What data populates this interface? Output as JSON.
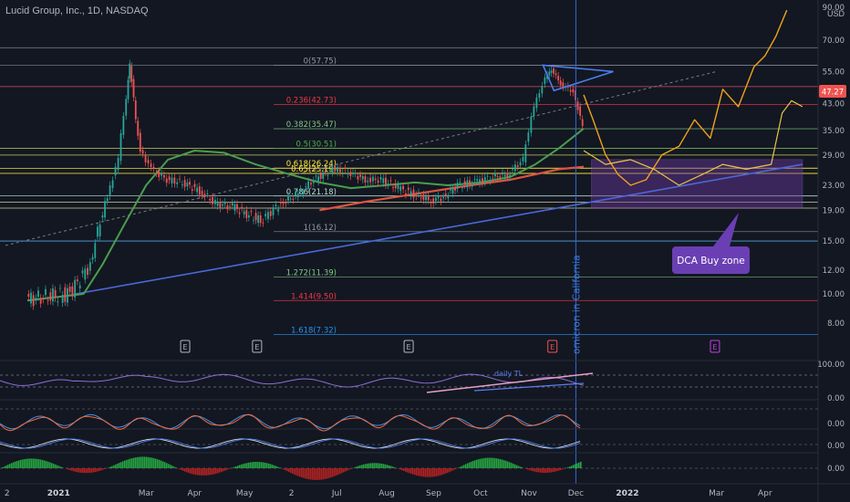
{
  "title": "Lucid Group, Inc., 1D, NASDAQ",
  "currency": "USD",
  "price_label": "47.27",
  "colors": {
    "bg": "#131722",
    "up": "#26a69a",
    "down": "#ef5350",
    "ma_green": "#4a9e4e",
    "ma_red": "#e0533f",
    "trend_blue": "#4a68d8",
    "proj_orange": "#f0a31c",
    "dca_box": "#6b3a9e",
    "vline": "#2f6bd6"
  },
  "chart_data": {
    "type": "line",
    "scale": "log",
    "ylim": [
      6,
      90
    ],
    "y_ticks": [
      "90.00",
      "70.00",
      "55.00",
      "43.00",
      "35.00",
      "29.00",
      "23.00",
      "19.00",
      "15.00",
      "12.00",
      "10.00",
      "8.00"
    ],
    "x_ticks": [
      "2",
      "2021",
      "Mar",
      "Apr",
      "May",
      "2",
      "Jul",
      "Aug",
      "Sep",
      "Oct",
      "Nov",
      "Dec",
      "2022",
      "Mar",
      "Apr"
    ],
    "fib_levels": [
      {
        "label": "0(57.75)",
        "value": 57.75,
        "color": "#9598a1"
      },
      {
        "label": "0.236(42.73)",
        "value": 42.73,
        "color": "#f23645"
      },
      {
        "label": "0.382(35.47)",
        "value": 35.47,
        "color": "#81c784"
      },
      {
        "label": "0.5(30.51)",
        "value": 30.51,
        "color": "#4caf50"
      },
      {
        "label": "0.618(26.24)",
        "value": 26.24,
        "color": "#ffeb3b"
      },
      {
        "label": "0.65(25.19)",
        "value": 25.19,
        "color": "#ffeb3b"
      },
      {
        "label": "0.786(21.18)",
        "value": 21.18,
        "color": "#b5dcc8"
      },
      {
        "label": "1(16.12)",
        "value": 16.12,
        "color": "#9598a1"
      },
      {
        "label": "1.272(11.39)",
        "value": 11.39,
        "color": "#81c784"
      },
      {
        "label": "1.414(9.50)",
        "value": 9.5,
        "color": "#f23645"
      },
      {
        "label": "1.618(7.32)",
        "value": 7.32,
        "color": "#2196f3"
      }
    ],
    "earnings_markers": [
      "E",
      "E",
      "E",
      "E",
      "E"
    ],
    "annotations": {
      "vertical_text": "omicron in California",
      "dca_label": "DCA Buy zone",
      "rsi_text": "daily TL"
    },
    "price_series": {
      "name": "Lucid Group, Inc.",
      "dates": [
        "2020-12-15",
        "2021-01-12",
        "2021-01-25",
        "2021-02-05",
        "2021-02-12",
        "2021-02-17",
        "2021-02-19",
        "2021-02-23",
        "2021-02-26",
        "2021-03-05",
        "2021-03-15",
        "2021-03-25",
        "2021-04-05",
        "2021-04-15",
        "2021-04-26",
        "2021-05-05",
        "2021-05-14",
        "2021-05-27",
        "2021-06-07",
        "2021-06-17",
        "2021-06-29",
        "2021-07-09",
        "2021-07-20",
        "2021-07-30",
        "2021-08-10",
        "2021-08-20",
        "2021-08-31",
        "2021-09-08",
        "2021-09-17",
        "2021-09-28",
        "2021-10-08",
        "2021-10-19",
        "2021-10-29",
        "2021-11-05",
        "2021-11-12",
        "2021-11-16",
        "2021-11-22",
        "2021-11-30",
        "2021-12-06"
      ],
      "values": [
        9.6,
        10.0,
        12.5,
        21.0,
        28.0,
        45.0,
        58.0,
        38.0,
        30.0,
        26.0,
        24.0,
        23.5,
        22.0,
        20.0,
        19.5,
        18.5,
        17.5,
        20.0,
        21.5,
        24.0,
        26.0,
        25.5,
        24.0,
        24.0,
        22.5,
        21.5,
        20.5,
        21.0,
        23.0,
        23.5,
        24.5,
        25.0,
        28.0,
        42.0,
        52.0,
        56.0,
        50.0,
        47.0,
        36.0
      ]
    },
    "projection_orange": {
      "dates": [
        "2021-12-06",
        "2021-12-12",
        "2021-12-20",
        "2021-12-28",
        "2022-01-05",
        "2022-01-15",
        "2022-01-25",
        "2022-02-05",
        "2022-02-15",
        "2022-02-25",
        "2022-03-05",
        "2022-03-15",
        "2022-03-25",
        "2022-04-01",
        "2022-04-08",
        "2022-04-15"
      ],
      "values": [
        46,
        38,
        29,
        25,
        23,
        24,
        29,
        31,
        38,
        33,
        48,
        42,
        57,
        62,
        72,
        88
      ]
    },
    "projection_yellow": {
      "dates": [
        "2021-12-06",
        "2021-12-20",
        "2022-01-05",
        "2022-01-20",
        "2022-02-05",
        "2022-02-20",
        "2022-03-05",
        "2022-03-20",
        "2022-04-05",
        "2022-04-12",
        "2022-04-18",
        "2022-04-25"
      ],
      "values": [
        30,
        27,
        28,
        26,
        23,
        25,
        27,
        26,
        27,
        40,
        44,
        42
      ]
    },
    "ma_green": {
      "dates": [
        "2020-12-15",
        "2021-01-20",
        "2021-02-01",
        "2021-02-15",
        "2021-03-01",
        "2021-03-15",
        "2021-04-01",
        "2021-04-20",
        "2021-05-10",
        "2021-06-01",
        "2021-06-20",
        "2021-07-10",
        "2021-08-01",
        "2021-08-20",
        "2021-09-10",
        "2021-10-01",
        "2021-10-20",
        "2021-11-05",
        "2021-11-20",
        "2021-12-06"
      ],
      "values": [
        9.5,
        10.0,
        12.5,
        17.0,
        23.0,
        28.0,
        30.0,
        29.5,
        27.0,
        25.0,
        23.5,
        22.5,
        23.0,
        23.5,
        23.0,
        23.5,
        24.5,
        27.0,
        30.5,
        35.5
      ]
    },
    "ma_red": {
      "dates": [
        "2021-06-20",
        "2021-07-20",
        "2021-08-20",
        "2021-09-20",
        "2021-10-20",
        "2021-11-05",
        "2021-11-20",
        "2021-12-06"
      ],
      "values": [
        19.0,
        20.3,
        21.5,
        22.8,
        24.0,
        25.0,
        26.0,
        26.5
      ]
    },
    "trend_blue": {
      "dates": [
        "2021-01-15",
        "2022-04-25"
      ],
      "values": [
        10.0,
        27.0
      ]
    },
    "trend_dashed": {
      "dates": [
        "2020-12-01",
        "2022-03-01"
      ],
      "values": [
        14.5,
        55.0
      ]
    },
    "triangle": {
      "dates": [
        "2021-11-10",
        "2021-12-25",
        "2021-11-17"
      ],
      "values": [
        57.75,
        55.0,
        47.5
      ]
    },
    "dca_zone": {
      "from": "2021-12-11",
      "to": "2022-04-25",
      "low": 19.3,
      "high": 28.0
    },
    "omicron_date": "2021-12-01",
    "hlines_extra": [
      {
        "value": 66.0,
        "color": "#7c7f89"
      },
      {
        "value": 57.75,
        "color": "#7c7f89"
      },
      {
        "value": 49.0,
        "color": "#e35a67"
      },
      {
        "value": 30.5,
        "color": "#d4e157"
      },
      {
        "value": 29.0,
        "color": "#d4e157"
      },
      {
        "value": 26.2,
        "color": "#ffeb3b"
      },
      {
        "value": 25.2,
        "color": "#ffeb3b"
      },
      {
        "value": 21.2,
        "color": "#b2dfdb"
      },
      {
        "value": 20.2,
        "color": "#e8e4a0"
      },
      {
        "value": 19.3,
        "color": "#e8e4a0"
      },
      {
        "value": 15.0,
        "color": "#56b6f0"
      }
    ],
    "indicators": [
      {
        "name": "rsi",
        "ticks": [
          "100.00",
          "0.00"
        ]
      },
      {
        "name": "stoch",
        "ticks": [
          "0.00"
        ]
      },
      {
        "name": "macd",
        "ticks": [
          "0.00"
        ]
      },
      {
        "name": "histogram",
        "ticks": [
          "0.00"
        ]
      }
    ]
  }
}
